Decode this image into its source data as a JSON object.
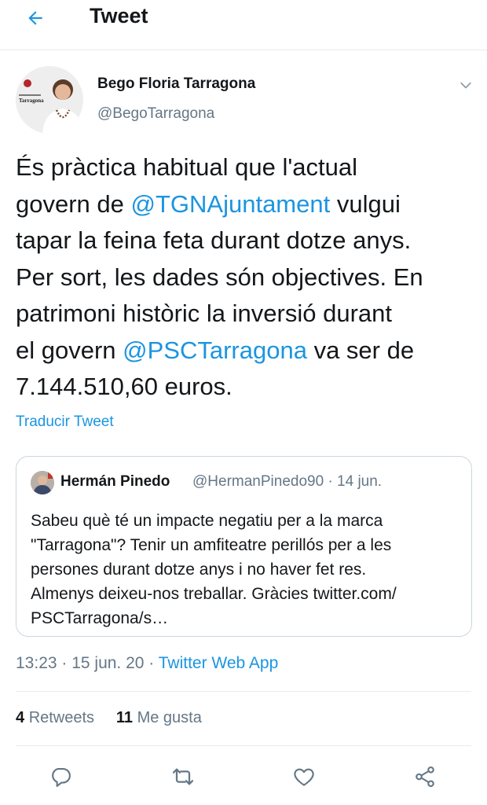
{
  "header": {
    "title": "Tweet",
    "back_icon": "arrow-left-icon"
  },
  "colors": {
    "accent": "#1b95e0",
    "text": "#14171a",
    "secondary": "#657786",
    "border": "#e6ecf0"
  },
  "tweet": {
    "author_name": "Bego Floria Tarragona",
    "author_handle": "@BegoTarragona",
    "avatar_caption": "Tarragona",
    "lines": {
      "l1": "És pràctica habitual que l'actual",
      "l2_pre": "govern de ",
      "l2_mention": "@TGNAjuntament",
      "l2_post": " vulgui",
      "l3": "tapar la feina feta durant dotze anys.",
      "l4": "Per sort, les dades són objectives. En",
      "l5": "patrimoni històric la inversió durant",
      "l6_pre": "el govern ",
      "l6_mention": "@PSCTarragona",
      "l6_post": " va ser de",
      "l7": "7.144.510,60 euros."
    },
    "translate_label": "Traducir Tweet"
  },
  "quoted": {
    "name": "Hermán Pinedo",
    "handle_and_date": "@HermanPinedo90 · 14 jun.",
    "lines": [
      "Sabeu què té un impacte negatiu per a la marca",
      "\"Tarragona\"? Tenir un amfiteatre perillós per a les",
      "persones durant dotze anys i no haver fet res.",
      "Almenys deixeu-nos treballar. Gràcies twitter.com/",
      "PSCTarragona/s…"
    ]
  },
  "meta": {
    "time_date": "13:23 · 15 jun. 20 · ",
    "source": "Twitter Web App"
  },
  "stats": {
    "retweets_count": "4",
    "retweets_label": "Retweets",
    "likes_count": "11",
    "likes_label": "Me gusta"
  },
  "actions": [
    "reply-icon",
    "retweet-icon",
    "like-icon",
    "share-icon"
  ]
}
